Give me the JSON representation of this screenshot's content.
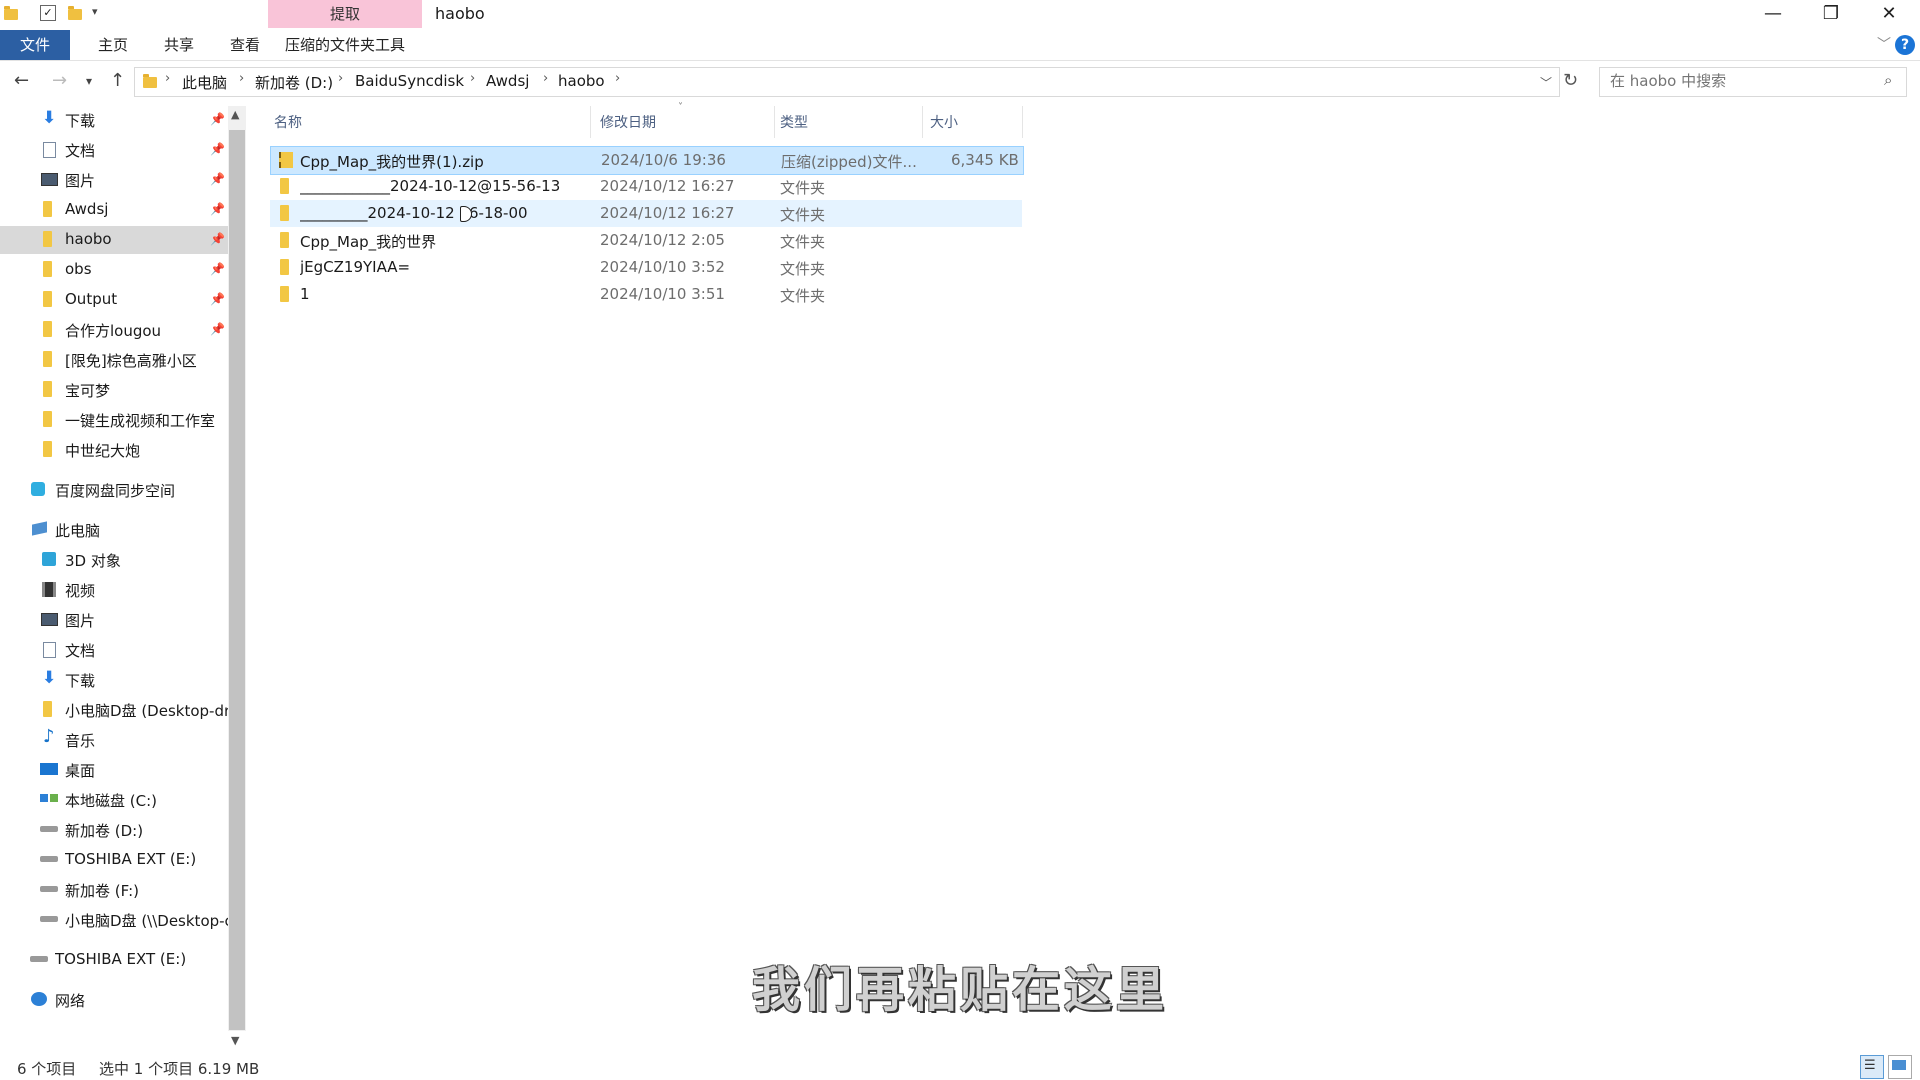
{
  "window": {
    "title": "haobo",
    "context_tab_group": "提取",
    "minimize": "—",
    "maximize": "❐",
    "close": "✕"
  },
  "ribbon": {
    "tabs": [
      "文件",
      "主页",
      "共享",
      "查看",
      "压缩的文件夹工具"
    ],
    "help": "?"
  },
  "address": {
    "crumbs": [
      "此电脑",
      "新加卷 (D:)",
      "BaiduSyncdisk",
      "Awdsj",
      "haobo"
    ],
    "search_placeholder": "在 haobo 中搜索"
  },
  "sidebar": {
    "quick_access": [
      {
        "label": "下载",
        "icon": "download-icon",
        "pinned": true
      },
      {
        "label": "文档",
        "icon": "document-icon",
        "pinned": true
      },
      {
        "label": "图片",
        "icon": "picture-icon",
        "pinned": true
      },
      {
        "label": "Awdsj",
        "icon": "folder-icon",
        "pinned": true
      },
      {
        "label": "haobo",
        "icon": "folder-icon",
        "pinned": true,
        "selected": true
      },
      {
        "label": "obs",
        "icon": "folder-icon",
        "pinned": true
      },
      {
        "label": "Output",
        "icon": "folder-icon",
        "pinned": true
      },
      {
        "label": "合作方lougou",
        "icon": "folder-icon",
        "pinned": true
      },
      {
        "label": "[限免]棕色高雅小区",
        "icon": "folder-icon",
        "pinned": false
      },
      {
        "label": "宝可梦",
        "icon": "folder-icon",
        "pinned": false
      },
      {
        "label": "一键生成视频和工作室",
        "icon": "folder-icon",
        "pinned": false
      },
      {
        "label": "中世纪大炮",
        "icon": "folder-icon",
        "pinned": false
      }
    ],
    "baidu": "百度网盘同步空间",
    "this_pc": "此电脑",
    "pc_items": [
      {
        "label": "3D 对象",
        "icon": "3d-objects-icon"
      },
      {
        "label": "视频",
        "icon": "video-icon"
      },
      {
        "label": "图片",
        "icon": "picture-icon"
      },
      {
        "label": "文档",
        "icon": "document-icon"
      },
      {
        "label": "下载",
        "icon": "download-icon"
      },
      {
        "label": "小电脑D盘 (Desktop-dr",
        "icon": "network-folder-icon"
      },
      {
        "label": "音乐",
        "icon": "music-icon"
      },
      {
        "label": "桌面",
        "icon": "desktop-icon"
      },
      {
        "label": "本地磁盘 (C:)",
        "icon": "windows-drive-icon"
      },
      {
        "label": "新加卷 (D:)",
        "icon": "drive-icon"
      },
      {
        "label": "TOSHIBA EXT (E:)",
        "icon": "drive-icon"
      },
      {
        "label": "新加卷 (F:)",
        "icon": "drive-icon"
      },
      {
        "label": "小电脑D盘 (\\\\Desktop-c",
        "icon": "network-drive-icon"
      }
    ],
    "toshiba": "TOSHIBA EXT (E:)",
    "network": "网络",
    "pin_glyph": "📌"
  },
  "filelist": {
    "columns": [
      "名称",
      "修改日期",
      "类型",
      "大小"
    ],
    "rows": [
      {
        "name": "Cpp_Map_我的世界(1).zip",
        "date": "2024/10/6 19:36",
        "type": "压缩(zipped)文件...",
        "size": "6,345 KB",
        "icon": "zip-folder-icon",
        "state": "selected"
      },
      {
        "name": "____________2024-10-12@15-56-13",
        "date": "2024/10/12 16:27",
        "type": "文件夹",
        "size": "",
        "icon": "folder-icon",
        "state": ""
      },
      {
        "name": "_________2024-10-12 16-18-00",
        "date": "2024/10/12 16:27",
        "type": "文件夹",
        "size": "",
        "icon": "folder-icon",
        "state": "hot"
      },
      {
        "name": "Cpp_Map_我的世界",
        "date": "2024/10/12 2:05",
        "type": "文件夹",
        "size": "",
        "icon": "folder-icon",
        "state": ""
      },
      {
        "name": "jEgCZ19YIAA=",
        "date": "2024/10/10 3:52",
        "type": "文件夹",
        "size": "",
        "icon": "folder-icon",
        "state": ""
      },
      {
        "name": "1",
        "date": "2024/10/10 3:51",
        "type": "文件夹",
        "size": "",
        "icon": "folder-icon",
        "state": ""
      }
    ]
  },
  "status": {
    "count": "6 个项目",
    "selection": "选中 1 个项目  6.19 MB"
  },
  "subtitle": "我们再粘贴在这里"
}
